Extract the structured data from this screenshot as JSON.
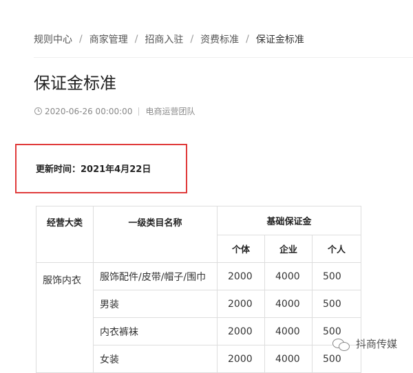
{
  "breadcrumb": {
    "items": [
      "规则中心",
      "商家管理",
      "招商入驻",
      "资费标准",
      "保证金标准"
    ],
    "separator": "/"
  },
  "page": {
    "title": "保证金标准",
    "datetime": "2020-06-26 00:00:00",
    "author": "电商运营团队",
    "clock_icon": "clock-icon"
  },
  "highlight": {
    "update_text": "更新时间：2021年4月22日",
    "border_color": "#e03a3a"
  },
  "table": {
    "headers": {
      "business_category": "经营大类",
      "primary_category": "一级类目名称",
      "deposit": "基础保证金",
      "individual_business": "个体",
      "enterprise": "企业",
      "personal": "个人"
    },
    "business_category": "服饰内衣",
    "rows": [
      {
        "category": "服饰配件/皮带/帽子/围巾",
        "individual": "2000",
        "enterprise": "4000",
        "personal": "500"
      },
      {
        "category": "男装",
        "individual": "2000",
        "enterprise": "4000",
        "personal": "500"
      },
      {
        "category": "内衣裤袜",
        "individual": "2000",
        "enterprise": "4000",
        "personal": "500"
      },
      {
        "category": "女装",
        "individual": "2000",
        "enterprise": "4000",
        "personal": "500"
      }
    ]
  },
  "watermark": {
    "text": "抖商传媒",
    "icon": "wechat-icon"
  }
}
